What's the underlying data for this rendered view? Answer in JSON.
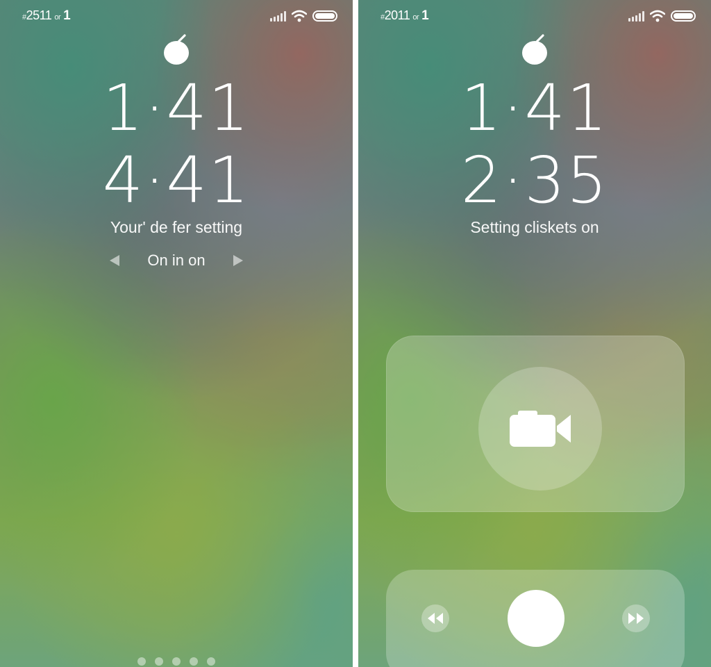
{
  "left_screen": {
    "status": {
      "carrier_prefix": "#",
      "carrier_number": "2511",
      "carrier_suffix": "or",
      "carrier_extra": "1",
      "icons": [
        "signal-icon",
        "wifi-icon",
        "battery-icon"
      ]
    },
    "logo": "apple-logo-icon",
    "time_primary": "1·41",
    "time_secondary": "4·41",
    "subtitle": "Your' de fer setting",
    "pager": {
      "label": "On in on",
      "prev_icon": "left-arrow-icon",
      "next_icon": "right-arrow-icon"
    },
    "page_dots": 5
  },
  "right_screen": {
    "status": {
      "carrier_prefix": "#",
      "carrier_number": "2011",
      "carrier_suffix": "or",
      "carrier_extra": "1",
      "icons": [
        "signal-icon",
        "wifi-icon",
        "battery-icon"
      ]
    },
    "logo": "apple-logo-icon",
    "time_primary": "1·41",
    "time_secondary": "2·35",
    "subtitle": "Setting cliskets on",
    "camera_panel": {
      "icon": "video-camera-icon"
    },
    "media_panel": {
      "rewind_icon": "rewind-icon",
      "fast_forward_icon": "fast-forward-icon",
      "shutter": "shutter-button"
    }
  },
  "colors": {
    "text": "#ffffff",
    "divider": "#ffffff"
  }
}
